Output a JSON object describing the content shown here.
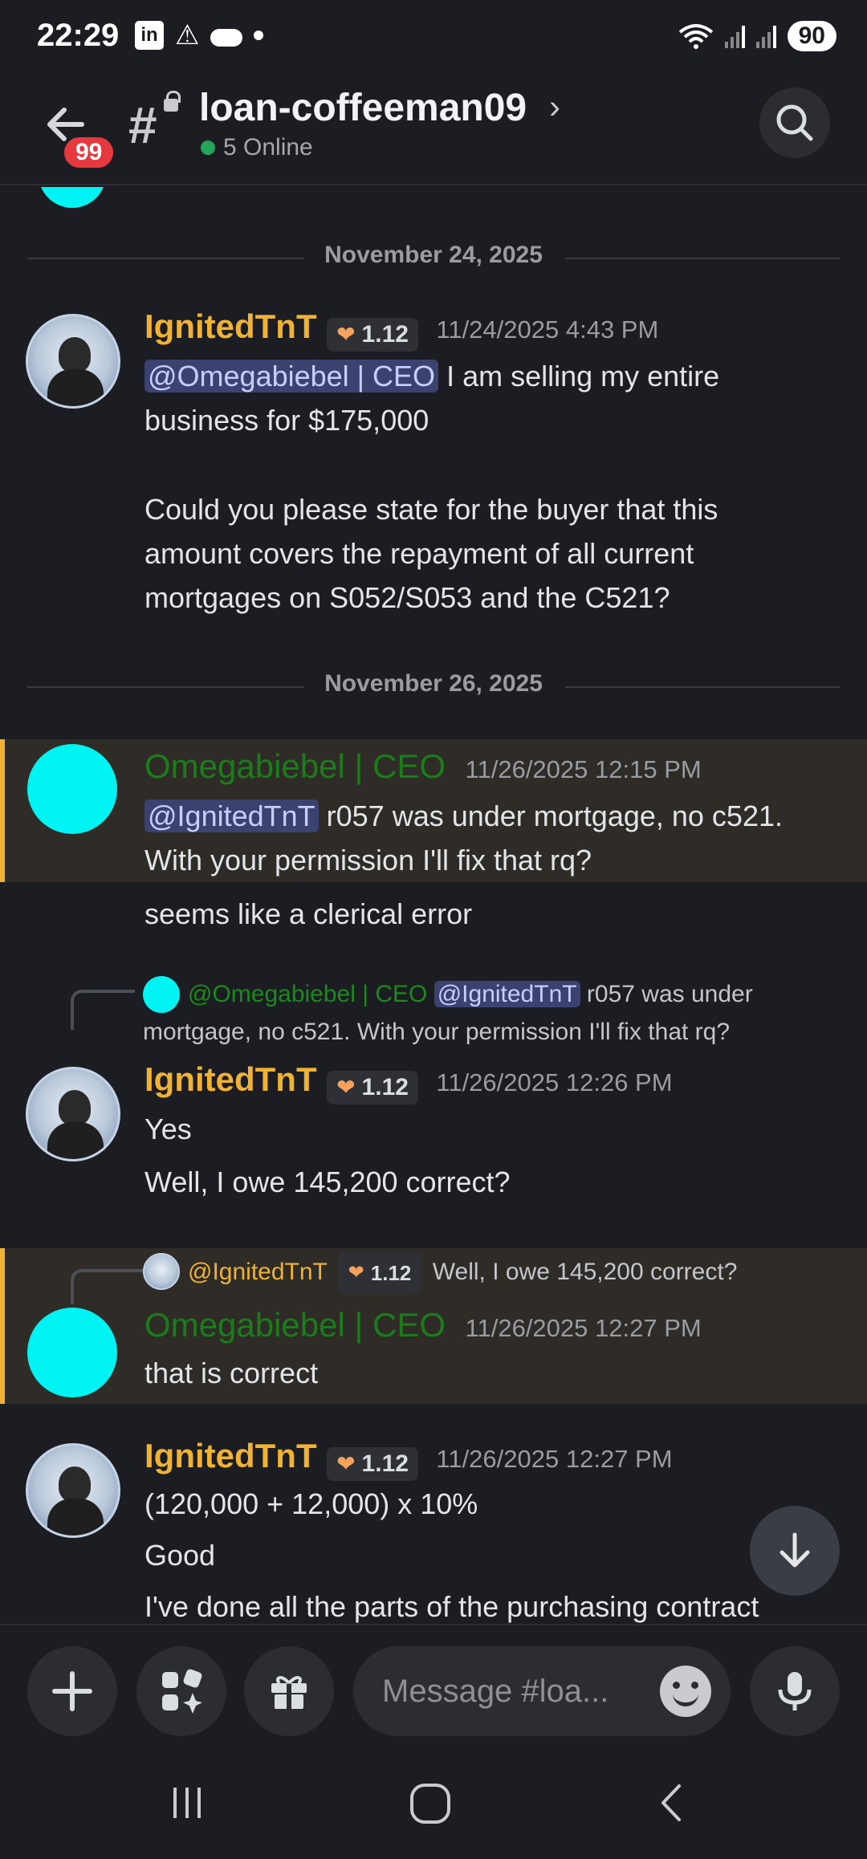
{
  "status_bar": {
    "time": "22:29",
    "linkedin_icon": "in",
    "warning_icon": "⚠",
    "battery": "90"
  },
  "header": {
    "badge": "99",
    "channel_name": "loan-coffeeman09",
    "online": "5 Online"
  },
  "messages": {
    "date1": "November 24, 2025",
    "m1": {
      "user": "IgnitedTnT",
      "badge": "1.12",
      "time": "11/24/2025 4:43 PM",
      "mention": "@Omegabiebel | CEO",
      "line1_rest": " I am selling my entire",
      "line2": "business for $175,000",
      "line3": "Could you please state for the buyer that this",
      "line4": "amount covers the repayment of all current",
      "line5": "mortgages on S052/S053 and the C521?"
    },
    "date2": "November 26, 2025",
    "m2": {
      "user": "Omegabiebel | CEO",
      "time": "11/26/2025 12:15 PM",
      "mention": "@IgnitedTnT",
      "line1_rest": " r057 was under mortgage, no c521.",
      "line2": "With your permission I'll fix that rq?",
      "line3": "seems like a clerical error"
    },
    "m3": {
      "reply_user": "@Omegabiebel | CEO",
      "reply_mention": "@IgnitedTnT",
      "reply_rest1": " r057 was under",
      "reply_line2": "mortgage, no c521. With your permission I'll fix that rq?",
      "user": "IgnitedTnT",
      "badge": "1.12",
      "time": "11/26/2025 12:26 PM",
      "line1": "Yes",
      "line2": "Well, I owe 145,200 correct?"
    },
    "m4": {
      "reply_user": "@IgnitedTnT",
      "reply_badge": "1.12",
      "reply_text": "Well, I owe 145,200 correct?",
      "user": "Omegabiebel | CEO",
      "time": "11/26/2025 12:27 PM",
      "line1": "that is correct"
    },
    "m5": {
      "user": "IgnitedTnT",
      "badge": "1.12",
      "time": "11/26/2025 12:27 PM",
      "line1": "(120,000 + 12,000) x 10%",
      "line2": "Good",
      "line3": "I've done all the parts of the purchasing contract"
    }
  },
  "composer": {
    "placeholder": "Message #loa..."
  },
  "colors": {
    "background": "#1c1d22",
    "gold_name": "#f0b232",
    "green_name": "#1a7d1a",
    "cyan_avatar": "#00f3f3",
    "mention_bg": "#3c4270"
  }
}
